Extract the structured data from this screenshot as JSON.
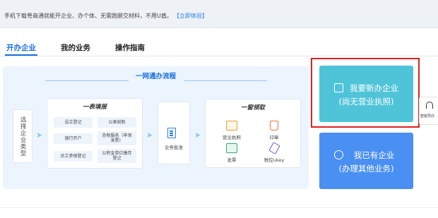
{
  "top_bar": {
    "notice": "手机下载粤商通就能开企业、办个体、无需跑腿交材料，不用U盾。",
    "try_link": "【立即体验】"
  },
  "tabs": [
    {
      "label": "开办企业",
      "active": true
    },
    {
      "label": "我的业务",
      "active": false
    },
    {
      "label": "操作指南",
      "active": false
    }
  ],
  "flow": {
    "title": "一网通办流程",
    "select_type": "选择企业类型",
    "form_card": {
      "title": "一表填报",
      "items": [
        "设立登记",
        "公章刻制",
        "银行开户",
        "办税服务（申领发票）",
        "员工参保登记",
        "公积金单位缴存登记"
      ]
    },
    "approval": {
      "label": "业务批准"
    },
    "pickup_card": {
      "title": "一窗领取",
      "items": [
        {
          "label": "营业执照",
          "icon": "license-icon"
        },
        {
          "label": "印章",
          "icon": "seal-icon"
        },
        {
          "label": "发票",
          "icon": "invoice-icon"
        },
        {
          "label": "税控ukey",
          "icon": "usb-key-icon"
        }
      ]
    }
  },
  "actions": {
    "new_company": {
      "line1": "我要新办企业",
      "line2": "(尚无营业执照)"
    },
    "existing_company": {
      "line1": "我已有企业",
      "line2": "(办理其他业务)"
    }
  },
  "side_help": {
    "label": "智能导办"
  },
  "colors": {
    "accent": "#1a6fe0",
    "new_button": "#4fc4d9",
    "existing_button": "#4a90f3",
    "highlight": "#e02020",
    "panel_bg": "#ecf5fd"
  }
}
